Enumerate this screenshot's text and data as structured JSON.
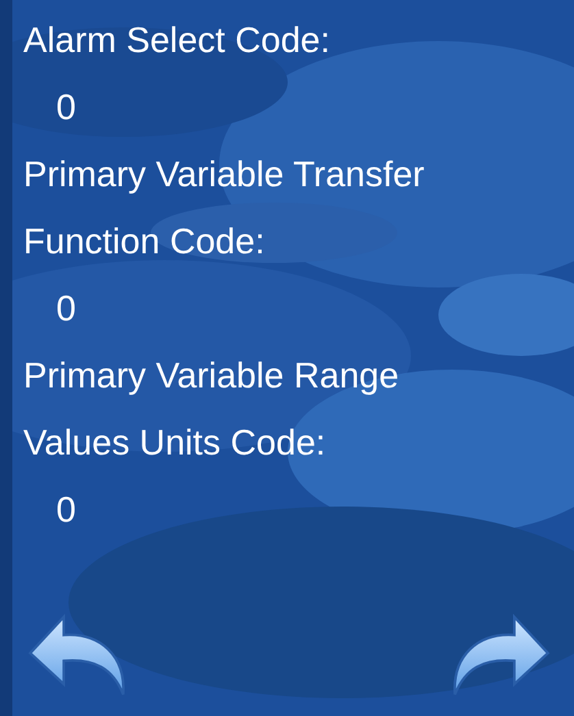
{
  "fields": [
    {
      "label": [
        "Alarm Select Code:"
      ],
      "value": "0"
    },
    {
      "label": [
        "Primary Variable Transfer",
        "Function Code:"
      ],
      "value": "0"
    },
    {
      "label": [
        "Primary Variable Range",
        "Values Units Code:"
      ],
      "value": "0"
    }
  ],
  "nav": [
    {
      "kind": "back"
    },
    {
      "kind": "forward"
    }
  ]
}
